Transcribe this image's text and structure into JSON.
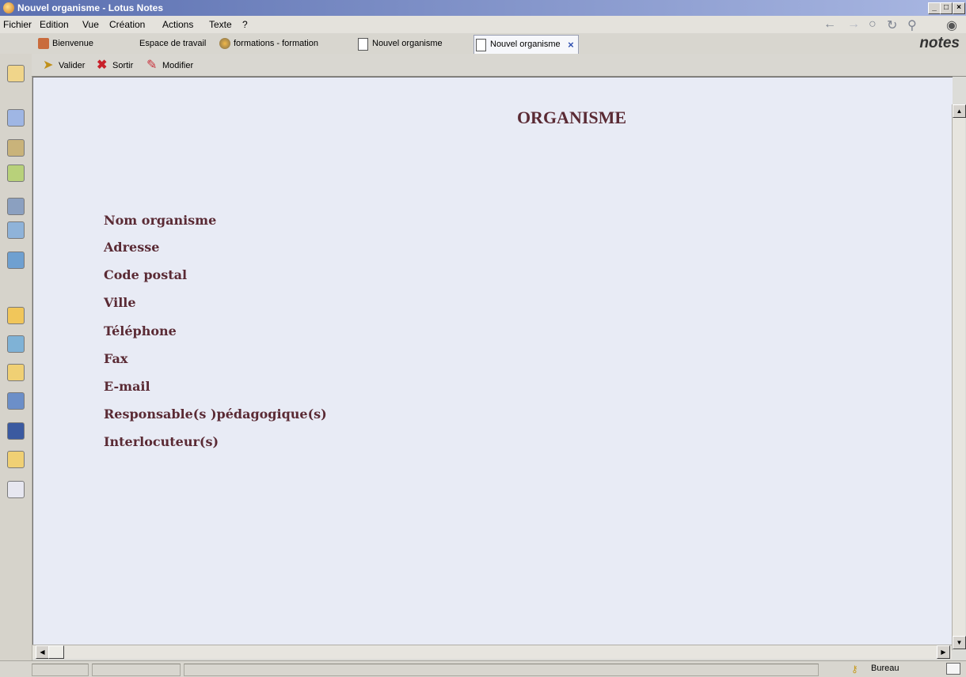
{
  "window": {
    "title": "Nouvel organisme - Lotus Notes",
    "controls": [
      "_",
      "□",
      "×"
    ]
  },
  "menu": [
    {
      "label": "Fichier"
    },
    {
      "label": "Edition"
    },
    {
      "label": "Vue"
    },
    {
      "label": "Création"
    },
    {
      "label": "Actions"
    },
    {
      "label": "Texte"
    },
    {
      "label": "?"
    }
  ],
  "nav_buttons": [
    "back-icon",
    "forward-icon",
    "stop-icon",
    "refresh-icon",
    "search-icon",
    "globe-icon"
  ],
  "tabs": [
    {
      "label": "Bienvenue",
      "icon": "home-icon"
    },
    {
      "label": "Espace de travail",
      "icon": ""
    },
    {
      "label": "formations - formation",
      "icon": "database-icon"
    },
    {
      "label": "Nouvel organisme",
      "icon": "document-icon"
    },
    {
      "label": "Nouvel organisme",
      "icon": "document-icon",
      "active": true
    }
  ],
  "brand": "notes",
  "actions": [
    {
      "label": "Valider",
      "icon": "validate-icon"
    },
    {
      "label": "Sortir",
      "icon": "exit-icon"
    },
    {
      "label": "Modifier",
      "icon": "edit-icon"
    }
  ],
  "form": {
    "title": "ORGANISME",
    "fields": [
      {
        "label": "Nom organisme",
        "value": ""
      },
      {
        "label": "Adresse",
        "value": ""
      },
      {
        "label": "Code postal",
        "value": ""
      },
      {
        "label": "Ville",
        "value": ""
      },
      {
        "label": "Téléphone",
        "value": ""
      },
      {
        "label": "Fax",
        "value": ""
      },
      {
        "label": "E-mail",
        "value": ""
      },
      {
        "label": "Responsable(s )pédagogique(s)",
        "value": ""
      },
      {
        "label": "Interlocuteur(s)",
        "value": ""
      }
    ]
  },
  "status": {
    "location": "Bureau"
  },
  "colors": {
    "label": "#5a2a34",
    "document_bg": "#e8ebf5",
    "chrome": "#d8d6cf"
  }
}
